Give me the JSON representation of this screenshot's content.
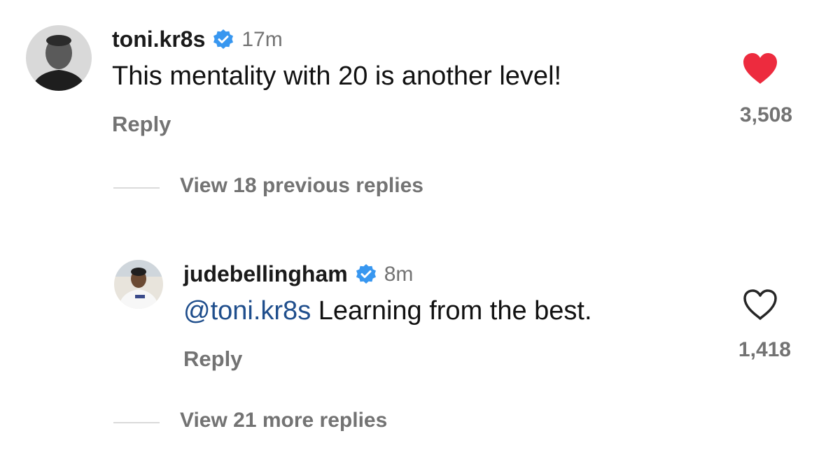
{
  "comments": [
    {
      "username": "toni.kr8s",
      "time": "17m",
      "text": "This mentality with 20 is another level!",
      "reply_label": "Reply",
      "likes": "3,508",
      "liked": true
    }
  ],
  "view_previous": {
    "label": "View 18 previous replies"
  },
  "reply_comment": {
    "username": "judebellingham",
    "time": "8m",
    "mention": "@toni.kr8s",
    "text": " Learning from the best.",
    "reply_label": "Reply",
    "likes": "1,418",
    "liked": false
  },
  "view_more": {
    "label": "View 21 more replies"
  },
  "colors": {
    "verified": "#3897f0",
    "heart_liked": "#ed2b3e",
    "mention": "#1f4e8c",
    "muted": "#737373"
  }
}
